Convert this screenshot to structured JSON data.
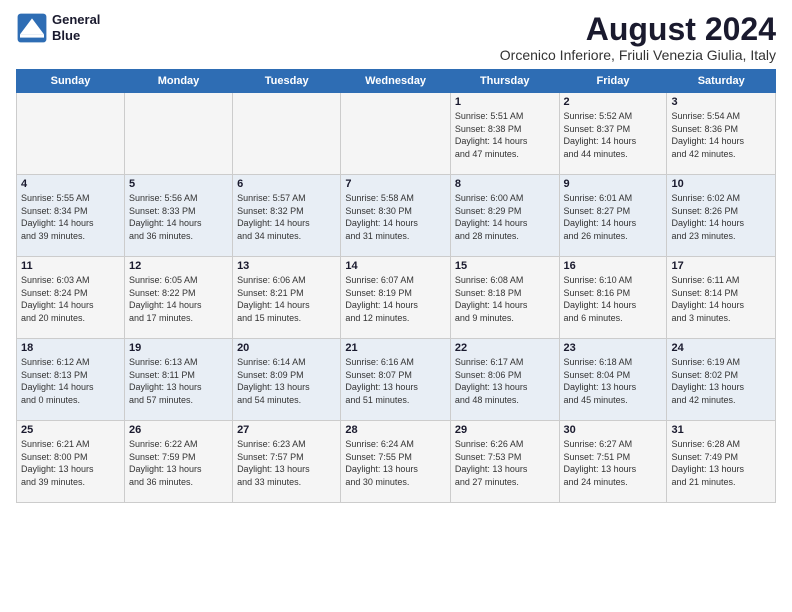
{
  "header": {
    "logo_line1": "General",
    "logo_line2": "Blue",
    "main_title": "August 2024",
    "subtitle": "Orcenico Inferiore, Friuli Venezia Giulia, Italy"
  },
  "weekdays": [
    "Sunday",
    "Monday",
    "Tuesday",
    "Wednesday",
    "Thursday",
    "Friday",
    "Saturday"
  ],
  "weeks": [
    [
      {
        "day": "",
        "info": ""
      },
      {
        "day": "",
        "info": ""
      },
      {
        "day": "",
        "info": ""
      },
      {
        "day": "",
        "info": ""
      },
      {
        "day": "1",
        "info": "Sunrise: 5:51 AM\nSunset: 8:38 PM\nDaylight: 14 hours\nand 47 minutes."
      },
      {
        "day": "2",
        "info": "Sunrise: 5:52 AM\nSunset: 8:37 PM\nDaylight: 14 hours\nand 44 minutes."
      },
      {
        "day": "3",
        "info": "Sunrise: 5:54 AM\nSunset: 8:36 PM\nDaylight: 14 hours\nand 42 minutes."
      }
    ],
    [
      {
        "day": "4",
        "info": "Sunrise: 5:55 AM\nSunset: 8:34 PM\nDaylight: 14 hours\nand 39 minutes."
      },
      {
        "day": "5",
        "info": "Sunrise: 5:56 AM\nSunset: 8:33 PM\nDaylight: 14 hours\nand 36 minutes."
      },
      {
        "day": "6",
        "info": "Sunrise: 5:57 AM\nSunset: 8:32 PM\nDaylight: 14 hours\nand 34 minutes."
      },
      {
        "day": "7",
        "info": "Sunrise: 5:58 AM\nSunset: 8:30 PM\nDaylight: 14 hours\nand 31 minutes."
      },
      {
        "day": "8",
        "info": "Sunrise: 6:00 AM\nSunset: 8:29 PM\nDaylight: 14 hours\nand 28 minutes."
      },
      {
        "day": "9",
        "info": "Sunrise: 6:01 AM\nSunset: 8:27 PM\nDaylight: 14 hours\nand 26 minutes."
      },
      {
        "day": "10",
        "info": "Sunrise: 6:02 AM\nSunset: 8:26 PM\nDaylight: 14 hours\nand 23 minutes."
      }
    ],
    [
      {
        "day": "11",
        "info": "Sunrise: 6:03 AM\nSunset: 8:24 PM\nDaylight: 14 hours\nand 20 minutes."
      },
      {
        "day": "12",
        "info": "Sunrise: 6:05 AM\nSunset: 8:22 PM\nDaylight: 14 hours\nand 17 minutes."
      },
      {
        "day": "13",
        "info": "Sunrise: 6:06 AM\nSunset: 8:21 PM\nDaylight: 14 hours\nand 15 minutes."
      },
      {
        "day": "14",
        "info": "Sunrise: 6:07 AM\nSunset: 8:19 PM\nDaylight: 14 hours\nand 12 minutes."
      },
      {
        "day": "15",
        "info": "Sunrise: 6:08 AM\nSunset: 8:18 PM\nDaylight: 14 hours\nand 9 minutes."
      },
      {
        "day": "16",
        "info": "Sunrise: 6:10 AM\nSunset: 8:16 PM\nDaylight: 14 hours\nand 6 minutes."
      },
      {
        "day": "17",
        "info": "Sunrise: 6:11 AM\nSunset: 8:14 PM\nDaylight: 14 hours\nand 3 minutes."
      }
    ],
    [
      {
        "day": "18",
        "info": "Sunrise: 6:12 AM\nSunset: 8:13 PM\nDaylight: 14 hours\nand 0 minutes."
      },
      {
        "day": "19",
        "info": "Sunrise: 6:13 AM\nSunset: 8:11 PM\nDaylight: 13 hours\nand 57 minutes."
      },
      {
        "day": "20",
        "info": "Sunrise: 6:14 AM\nSunset: 8:09 PM\nDaylight: 13 hours\nand 54 minutes."
      },
      {
        "day": "21",
        "info": "Sunrise: 6:16 AM\nSunset: 8:07 PM\nDaylight: 13 hours\nand 51 minutes."
      },
      {
        "day": "22",
        "info": "Sunrise: 6:17 AM\nSunset: 8:06 PM\nDaylight: 13 hours\nand 48 minutes."
      },
      {
        "day": "23",
        "info": "Sunrise: 6:18 AM\nSunset: 8:04 PM\nDaylight: 13 hours\nand 45 minutes."
      },
      {
        "day": "24",
        "info": "Sunrise: 6:19 AM\nSunset: 8:02 PM\nDaylight: 13 hours\nand 42 minutes."
      }
    ],
    [
      {
        "day": "25",
        "info": "Sunrise: 6:21 AM\nSunset: 8:00 PM\nDaylight: 13 hours\nand 39 minutes."
      },
      {
        "day": "26",
        "info": "Sunrise: 6:22 AM\nSunset: 7:59 PM\nDaylight: 13 hours\nand 36 minutes."
      },
      {
        "day": "27",
        "info": "Sunrise: 6:23 AM\nSunset: 7:57 PM\nDaylight: 13 hours\nand 33 minutes."
      },
      {
        "day": "28",
        "info": "Sunrise: 6:24 AM\nSunset: 7:55 PM\nDaylight: 13 hours\nand 30 minutes."
      },
      {
        "day": "29",
        "info": "Sunrise: 6:26 AM\nSunset: 7:53 PM\nDaylight: 13 hours\nand 27 minutes."
      },
      {
        "day": "30",
        "info": "Sunrise: 6:27 AM\nSunset: 7:51 PM\nDaylight: 13 hours\nand 24 minutes."
      },
      {
        "day": "31",
        "info": "Sunrise: 6:28 AM\nSunset: 7:49 PM\nDaylight: 13 hours\nand 21 minutes."
      }
    ]
  ]
}
